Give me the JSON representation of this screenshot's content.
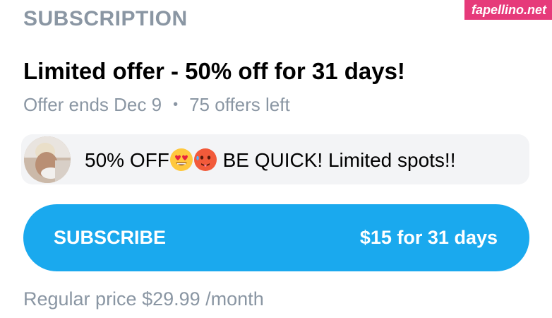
{
  "header": {
    "section_title": "SUBSCRIPTION"
  },
  "watermark": {
    "text": "fapellino.net"
  },
  "offer": {
    "title": "Limited offer - 50% off for 31 days!",
    "ends": "Offer ends Dec 9",
    "separator": "•",
    "remaining": "75 offers left"
  },
  "message": {
    "text_prefix": "50% OFF",
    "emojis": [
      "heart-eyes-emoji",
      "hot-face-emoji"
    ],
    "text_suffix": " BE QUICK! Limited spots!!"
  },
  "subscribe_button": {
    "label": "SUBSCRIBE",
    "price": "$15 for 31 days"
  },
  "regular_price": "Regular price $29.99 /month",
  "colors": {
    "accent": "#1aa9ee",
    "muted_text": "#8a96a3",
    "message_bg": "#f3f4f6",
    "watermark_bg": "#e63a7a"
  }
}
